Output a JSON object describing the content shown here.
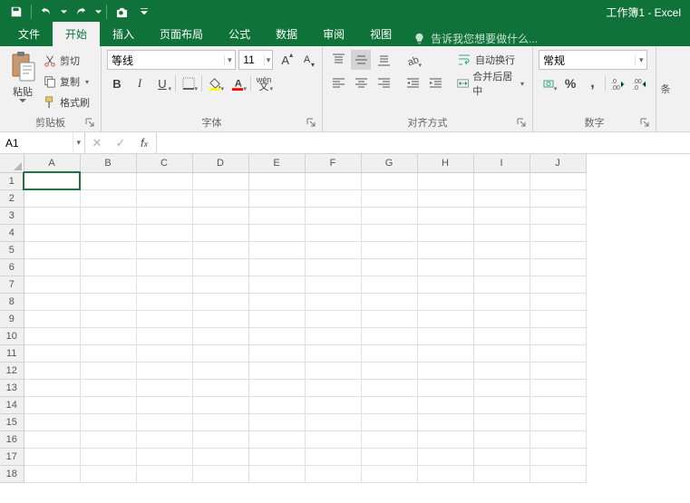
{
  "title": "工作簿1 - Excel",
  "qat_icons": [
    "save-icon",
    "undo-icon",
    "redo-icon",
    "camera-icon"
  ],
  "tabs": [
    {
      "label": "文件",
      "id": "file"
    },
    {
      "label": "开始",
      "id": "home",
      "active": true
    },
    {
      "label": "插入",
      "id": "insert"
    },
    {
      "label": "页面布局",
      "id": "layout"
    },
    {
      "label": "公式",
      "id": "formulas"
    },
    {
      "label": "数据",
      "id": "data"
    },
    {
      "label": "审阅",
      "id": "review"
    },
    {
      "label": "视图",
      "id": "view"
    }
  ],
  "tell_me_placeholder": "告诉我您想要做什么...",
  "ribbon": {
    "clipboard": {
      "paste": "粘贴",
      "cut": "剪切",
      "copy": "复制",
      "format_painter": "格式刷",
      "group_label": "剪贴板"
    },
    "font": {
      "font_name": "等线",
      "font_size": "11",
      "group_label": "字体",
      "pinyin_label": "wén"
    },
    "alignment": {
      "wrap_text": "自动换行",
      "merge_center": "合并后居中",
      "group_label": "对齐方式"
    },
    "number": {
      "format": "常规",
      "group_label": "数字"
    },
    "trailing": "条"
  },
  "namebox": "A1",
  "formula": "",
  "columns": [
    "A",
    "B",
    "C",
    "D",
    "E",
    "F",
    "G",
    "H",
    "I",
    "J"
  ],
  "rows": [
    1,
    2,
    3,
    4,
    5,
    6,
    7,
    8,
    9,
    10,
    11,
    12,
    13,
    14,
    15,
    16,
    17,
    18
  ],
  "selected_cell": "A1"
}
